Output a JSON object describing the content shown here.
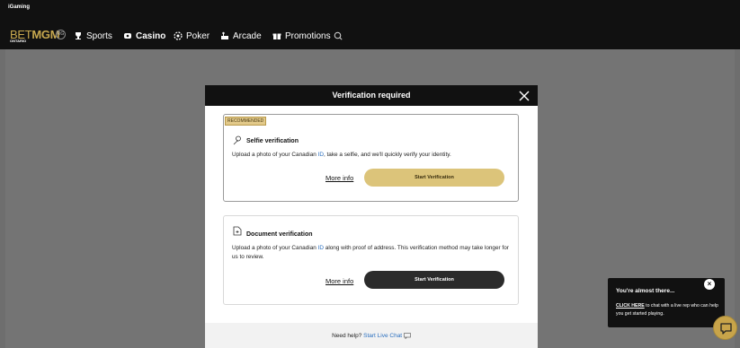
{
  "header": {
    "igaming_label": "iGaming",
    "logo_bet": "BET",
    "logo_mgm": "MGM",
    "logo_region": "ONTARIO",
    "rg_badge": "RG",
    "nav": [
      {
        "label": "Sports",
        "icon": "trophy-icon"
      },
      {
        "label": "Casino",
        "icon": "casino-chip-icon"
      },
      {
        "label": "Poker",
        "icon": "poker-chip-icon"
      },
      {
        "label": "Arcade",
        "icon": "arcade-icon"
      },
      {
        "label": "Promotions",
        "icon": "gift-icon"
      }
    ],
    "search_icon": "search-icon"
  },
  "modal": {
    "title": "Verification required",
    "close_icon": "close-icon",
    "selfie": {
      "badge": "RECOMMENDED",
      "title": "Selfie verification",
      "icon": "selfie-icon",
      "text_before": "Upload a photo of your Canadian ",
      "text_highlight": "ID",
      "text_after": ", take a selfie, and we'll quickly verify your identity.",
      "more_info": "More info",
      "button": "Start Verification"
    },
    "document": {
      "title": "Document verification",
      "icon": "document-icon",
      "text_before": "Upload a photo of your Canadian ",
      "text_highlight": "ID",
      "text_after": " along with proof of address. This verification method may take longer for us to review.",
      "more_info": "More info",
      "button": "Start Verification"
    },
    "footer": {
      "help": "Need help?",
      "live_chat": "Start Live Chat"
    }
  },
  "chat": {
    "title": "You're almost there...",
    "link": "CLICK HERE",
    "text": " to chat with a live rep who can help you get started playing.",
    "close": "×"
  },
  "colors": {
    "accent_gold": "#dcc47a",
    "brand_gold": "#c8a94f",
    "link_blue": "#2a6fbf",
    "header_bg": "#111111"
  }
}
